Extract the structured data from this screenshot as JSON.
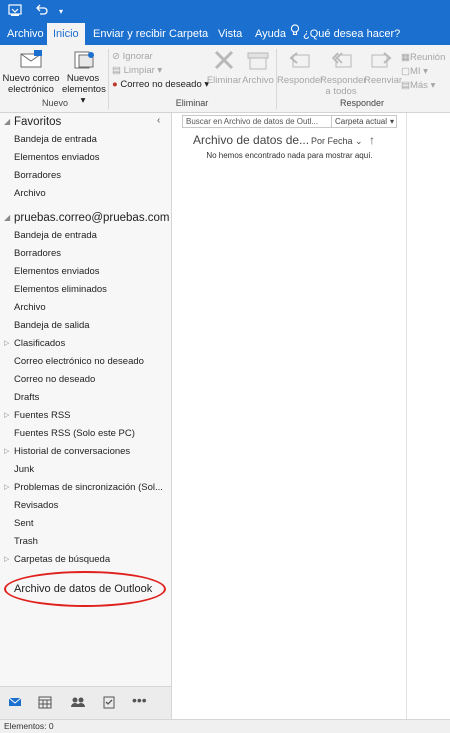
{
  "menu": {
    "tabs": [
      "Archivo",
      "Inicio",
      "Enviar y recibir",
      "Carpeta",
      "Vista",
      "Ayuda"
    ],
    "active_tab": "Inicio",
    "tell_me": "¿Qué desea hacer?"
  },
  "ribbon": {
    "nuevo": {
      "new_email": [
        "Nuevo correo",
        "electrónico"
      ],
      "new_items": [
        "Nuevos",
        "elementos"
      ],
      "group_label": "Nuevo"
    },
    "eliminar": {
      "ignorar": "Ignorar",
      "limpiar": "Limpiar",
      "correo_no_deseado": "Correo no deseado",
      "eliminar": "Eliminar",
      "archivo": "Archivo",
      "group_label": "Eliminar"
    },
    "responder": {
      "responder": "Responder",
      "responder_todos": [
        "Responder",
        "a todos"
      ],
      "reenviar": "Reenviar",
      "reunion": "Reunión",
      "mi": "MI",
      "mas": "Más",
      "group_label": "Responder"
    }
  },
  "search": {
    "placeholder": "Buscar en Archivo de datos de Outl...",
    "scope": "Carpeta actual"
  },
  "message_list": {
    "header": "Archivo de datos de...",
    "sort": "Por Fecha",
    "empty_text": "No hemos encontrado nada para mostrar aquí."
  },
  "sidebar": {
    "favorites_label": "Favoritos",
    "favorites": [
      "Bandeja de entrada",
      "Elementos enviados",
      "Borradores",
      "Archivo"
    ],
    "account": "pruebas.correo@pruebas.com",
    "account_folders": [
      {
        "label": "Bandeja de entrada",
        "expandable": false
      },
      {
        "label": "Borradores",
        "expandable": false
      },
      {
        "label": "Elementos enviados",
        "expandable": false
      },
      {
        "label": "Elementos eliminados",
        "expandable": false
      },
      {
        "label": "Archivo",
        "expandable": false
      },
      {
        "label": "Bandeja de salida",
        "expandable": false
      },
      {
        "label": "Clasificados",
        "expandable": true
      },
      {
        "label": "Correo electrónico no deseado",
        "expandable": false
      },
      {
        "label": "Correo no deseado",
        "expandable": false
      },
      {
        "label": "Drafts",
        "expandable": false
      },
      {
        "label": "Fuentes RSS",
        "expandable": true
      },
      {
        "label": "Fuentes RSS (Solo este PC)",
        "expandable": false
      },
      {
        "label": "Historial de conversaciones",
        "expandable": true
      },
      {
        "label": "Junk",
        "expandable": false
      },
      {
        "label": "Problemas de sincronización (Sol...",
        "expandable": true
      },
      {
        "label": "Revisados",
        "expandable": false
      },
      {
        "label": "Sent",
        "expandable": false
      },
      {
        "label": "Trash",
        "expandable": false
      },
      {
        "label": "Carpetas de búsqueda",
        "expandable": true
      }
    ],
    "data_file": "Archivo de datos de Outlook"
  },
  "status": {
    "items": "Elementos: 0"
  },
  "colors": {
    "accent": "#1a6fcf",
    "highlight_circle": "#e0201c"
  },
  "icons": [
    "send-receive-icon",
    "undo-icon",
    "customize-qat-icon",
    "lightbulb-icon",
    "new-email-icon",
    "new-items-icon",
    "ignore-icon",
    "clean-up-icon",
    "junk-icon",
    "delete-icon",
    "archive-icon",
    "reply-icon",
    "reply-all-icon",
    "forward-icon",
    "meeting-icon",
    "im-icon",
    "more-icon",
    "collapse-icon",
    "mail-icon",
    "calendar-icon",
    "people-icon",
    "tasks-icon",
    "more-nav-icon",
    "sort-arrow-icon"
  ]
}
